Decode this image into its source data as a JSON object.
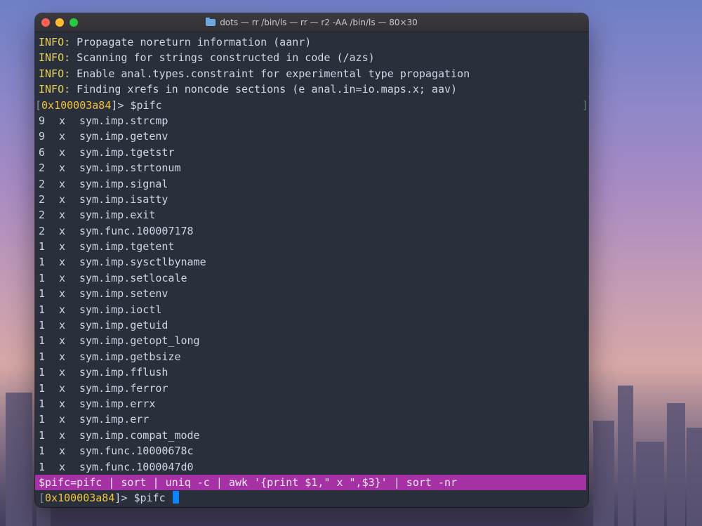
{
  "window": {
    "title": "dots — rr /bin/ls — rr — r2 -AA /bin/ls — 80×30"
  },
  "info_lines": [
    {
      "tag": "INFO:",
      "text": " Propagate noreturn information (aanr)"
    },
    {
      "tag": "INFO:",
      "text": " Scanning for strings constructed in code (/azs)"
    },
    {
      "tag": "INFO:",
      "text": " Enable anal.types.constraint for experimental type propagation"
    },
    {
      "tag": "INFO:",
      "text": " Finding xrefs in noncode sections (e anal.in=io.maps.x; aav)"
    }
  ],
  "prompt": {
    "open": "[",
    "address": "0x100003a84",
    "close": "]>",
    "command": " $pifc",
    "right_bracket": "]"
  },
  "results": [
    {
      "count": "9",
      "x": "x",
      "symbol": "sym.imp.strcmp"
    },
    {
      "count": "9",
      "x": "x",
      "symbol": "sym.imp.getenv"
    },
    {
      "count": "6",
      "x": "x",
      "symbol": "sym.imp.tgetstr"
    },
    {
      "count": "2",
      "x": "x",
      "symbol": "sym.imp.strtonum"
    },
    {
      "count": "2",
      "x": "x",
      "symbol": "sym.imp.signal"
    },
    {
      "count": "2",
      "x": "x",
      "symbol": "sym.imp.isatty"
    },
    {
      "count": "2",
      "x": "x",
      "symbol": "sym.imp.exit"
    },
    {
      "count": "2",
      "x": "x",
      "symbol": "sym.func.100007178"
    },
    {
      "count": "1",
      "x": "x",
      "symbol": "sym.imp.tgetent"
    },
    {
      "count": "1",
      "x": "x",
      "symbol": "sym.imp.sysctlbyname"
    },
    {
      "count": "1",
      "x": "x",
      "symbol": "sym.imp.setlocale"
    },
    {
      "count": "1",
      "x": "x",
      "symbol": "sym.imp.setenv"
    },
    {
      "count": "1",
      "x": "x",
      "symbol": "sym.imp.ioctl"
    },
    {
      "count": "1",
      "x": "x",
      "symbol": "sym.imp.getuid"
    },
    {
      "count": "1",
      "x": "x",
      "symbol": "sym.imp.getopt_long"
    },
    {
      "count": "1",
      "x": "x",
      "symbol": "sym.imp.getbsize"
    },
    {
      "count": "1",
      "x": "x",
      "symbol": "sym.imp.fflush"
    },
    {
      "count": "1",
      "x": "x",
      "symbol": "sym.imp.ferror"
    },
    {
      "count": "1",
      "x": "x",
      "symbol": "sym.imp.errx"
    },
    {
      "count": "1",
      "x": "x",
      "symbol": "sym.imp.err"
    },
    {
      "count": "1",
      "x": "x",
      "symbol": "sym.imp.compat_mode"
    },
    {
      "count": "1",
      "x": "x",
      "symbol": "sym.func.10000678c"
    },
    {
      "count": "1",
      "x": "x",
      "symbol": "sym.func.1000047d0"
    }
  ],
  "hint_line": "$pifc=pifc | sort | uniq -c | awk '{print $1,\" x \",$3}' | sort -nr",
  "input": {
    "open": "[",
    "address": "0x100003a84",
    "close": "]>",
    "command": " $pifc"
  },
  "colors": {
    "info_tag": "#e8d25a",
    "address": "#f0c43c",
    "hint_background": "#a531a4",
    "cursor": "#0a84ff"
  }
}
